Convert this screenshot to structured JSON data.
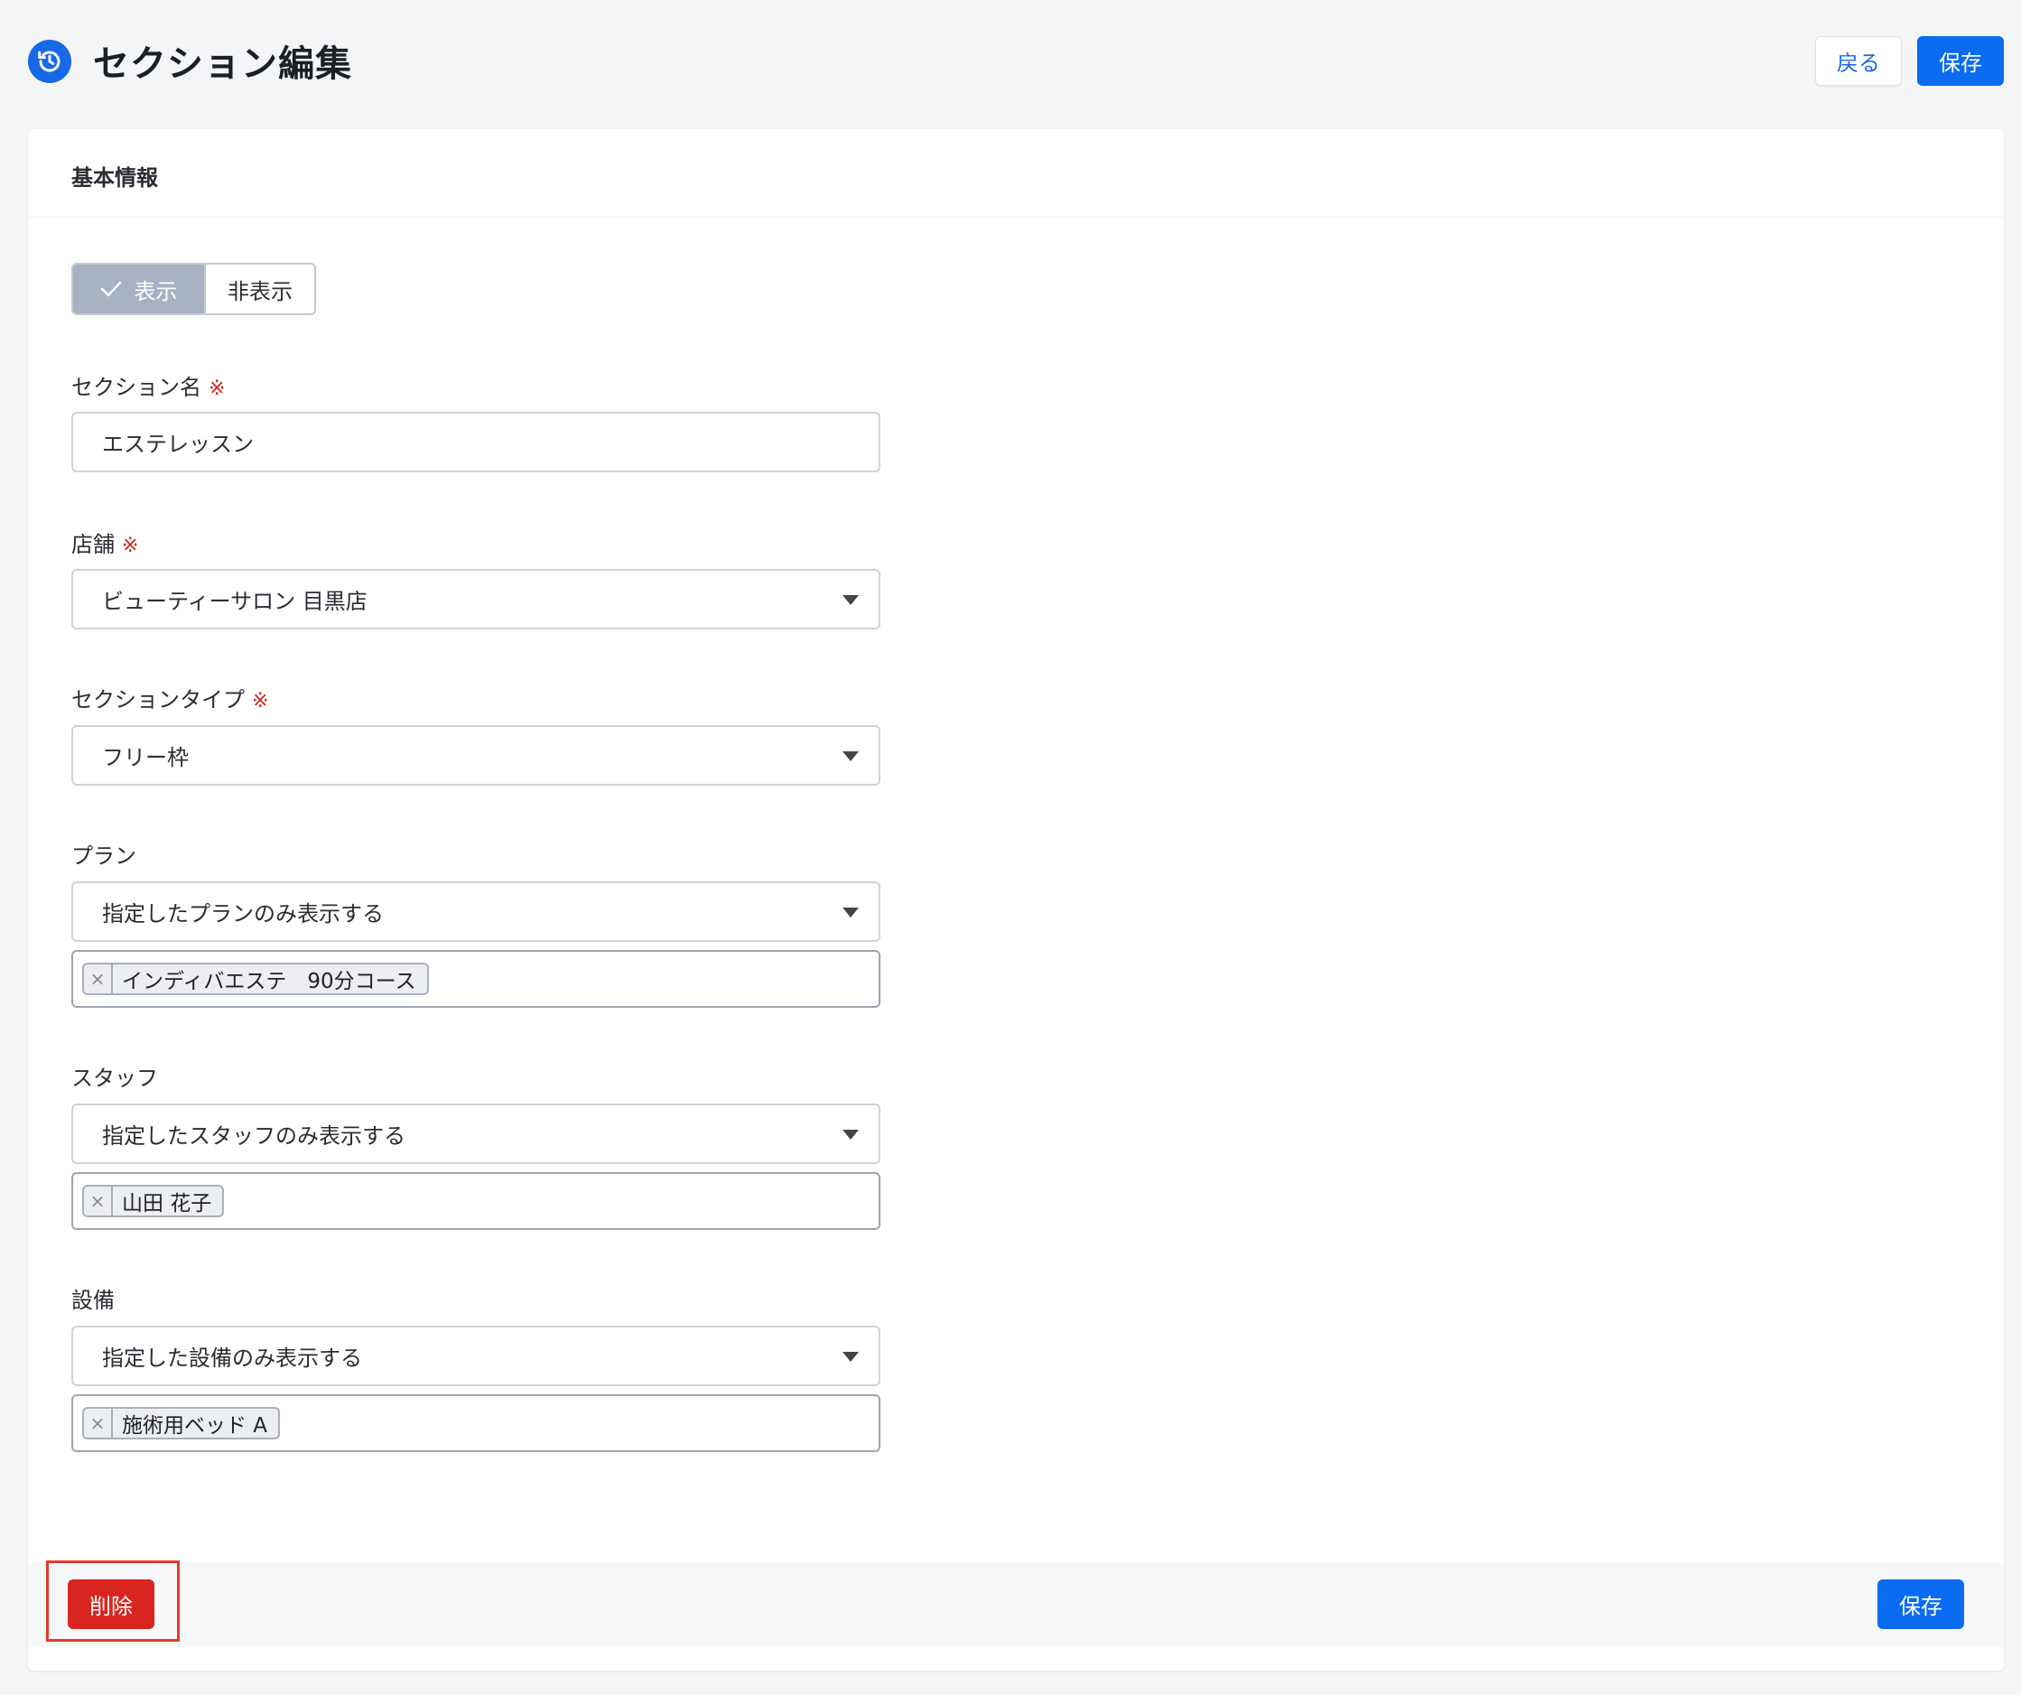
{
  "header": {
    "title": "セクション編集",
    "icon": "history-icon",
    "back_label": "戻る",
    "save_label": "保存"
  },
  "card": {
    "title": "基本情報",
    "visibility": {
      "on_label": "表示",
      "off_label": "非表示",
      "selected": "表示"
    },
    "required_mark": "※",
    "fields": {
      "section_name": {
        "label": "セクション名",
        "value": "エステレッスン"
      },
      "store": {
        "label": "店舗",
        "value": "ビューティーサロン 目黒店"
      },
      "section_type": {
        "label": "セクションタイプ",
        "value": "フリー枠"
      },
      "plan": {
        "label": "プラン",
        "value": "指定したプランのみ表示する",
        "tags": [
          "インディバエステ　90分コース"
        ]
      },
      "staff": {
        "label": "スタッフ",
        "value": "指定したスタッフのみ表示する",
        "tags": [
          "山田 花子"
        ]
      },
      "equipment": {
        "label": "設備",
        "value": "指定した設備のみ表示する",
        "tags": [
          "施術用ベッド A"
        ]
      }
    }
  },
  "footer": {
    "delete_label": "削除",
    "save_label": "保存"
  },
  "colors": {
    "primary": "#0a6cf0",
    "danger": "#d9251f",
    "required": "#d0251f",
    "toggle_active": "#a9b1c4"
  }
}
